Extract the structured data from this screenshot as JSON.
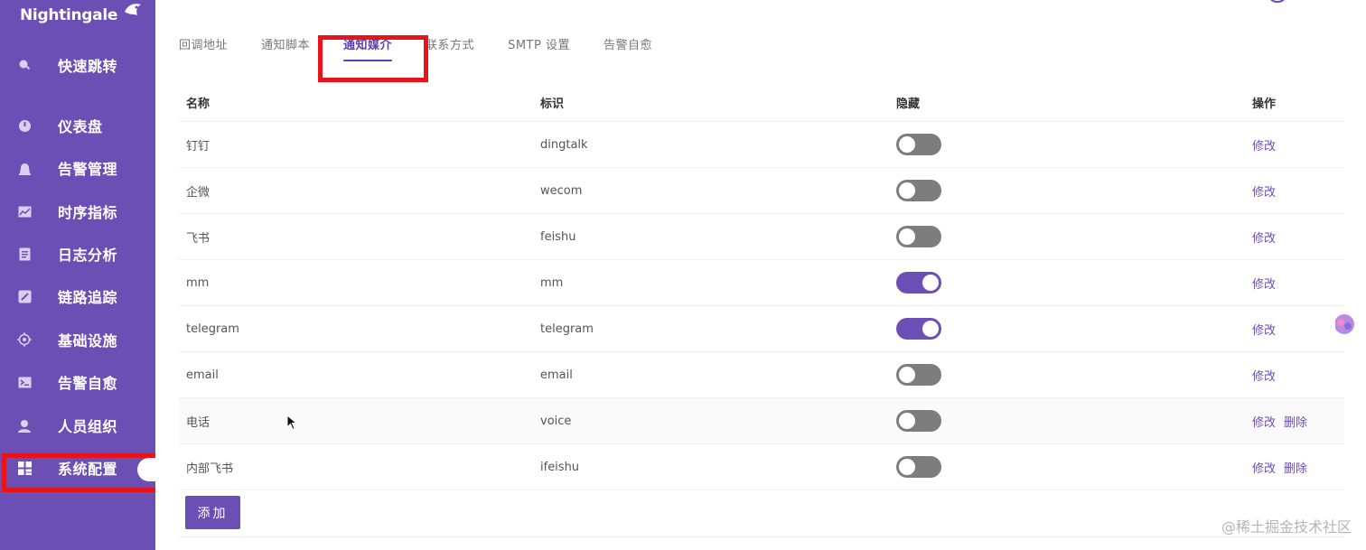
{
  "app": {
    "name": "Nightingale"
  },
  "sidebar": {
    "items": [
      {
        "label": "快速跳转",
        "icon": "search-icon"
      },
      {
        "label": "仪表盘",
        "icon": "dashboard-icon"
      },
      {
        "label": "告警管理",
        "icon": "alarm-icon"
      },
      {
        "label": "时序指标",
        "icon": "line-chart-icon"
      },
      {
        "label": "日志分析",
        "icon": "log-icon"
      },
      {
        "label": "链路追踪",
        "icon": "trace-icon"
      },
      {
        "label": "基础设施",
        "icon": "infrastructure-icon"
      },
      {
        "label": "告警自愈",
        "icon": "terminal-icon"
      },
      {
        "label": "人员组织",
        "icon": "user-icon"
      },
      {
        "label": "系统配置",
        "icon": "grid-icon",
        "active": true
      }
    ]
  },
  "tabs": [
    {
      "label": "回调地址"
    },
    {
      "label": "通知脚本"
    },
    {
      "label": "通知媒介",
      "active": true
    },
    {
      "label": "联系方式"
    },
    {
      "label": "SMTP 设置"
    },
    {
      "label": "告警自愈"
    }
  ],
  "table": {
    "headers": [
      "名称",
      "标识",
      "隐藏",
      "操作"
    ],
    "rows": [
      {
        "name": "钉钉",
        "ident": "dingtalk",
        "hidden": false,
        "actions": [
          "修改"
        ]
      },
      {
        "name": "企微",
        "ident": "wecom",
        "hidden": false,
        "actions": [
          "修改"
        ]
      },
      {
        "name": "飞书",
        "ident": "feishu",
        "hidden": false,
        "actions": [
          "修改"
        ]
      },
      {
        "name": "mm",
        "ident": "mm",
        "hidden": true,
        "actions": [
          "修改"
        ]
      },
      {
        "name": "telegram",
        "ident": "telegram",
        "hidden": true,
        "actions": [
          "修改"
        ]
      },
      {
        "name": "email",
        "ident": "email",
        "hidden": false,
        "actions": [
          "修改"
        ]
      },
      {
        "name": "电话",
        "ident": "voice",
        "hidden": false,
        "actions": [
          "修改",
          "删除"
        ]
      },
      {
        "name": "内部飞书",
        "ident": "ifeishu",
        "hidden": false,
        "actions": [
          "修改",
          "删除"
        ]
      }
    ]
  },
  "add_button": {
    "label": "添加"
  },
  "watermark": "@稀土掘金技术社区",
  "colors": {
    "sidebar": "#6b4fb5",
    "accent": "#6b4fb5",
    "switch_off": "#7d7d7d",
    "highlight": "#e8141b"
  }
}
